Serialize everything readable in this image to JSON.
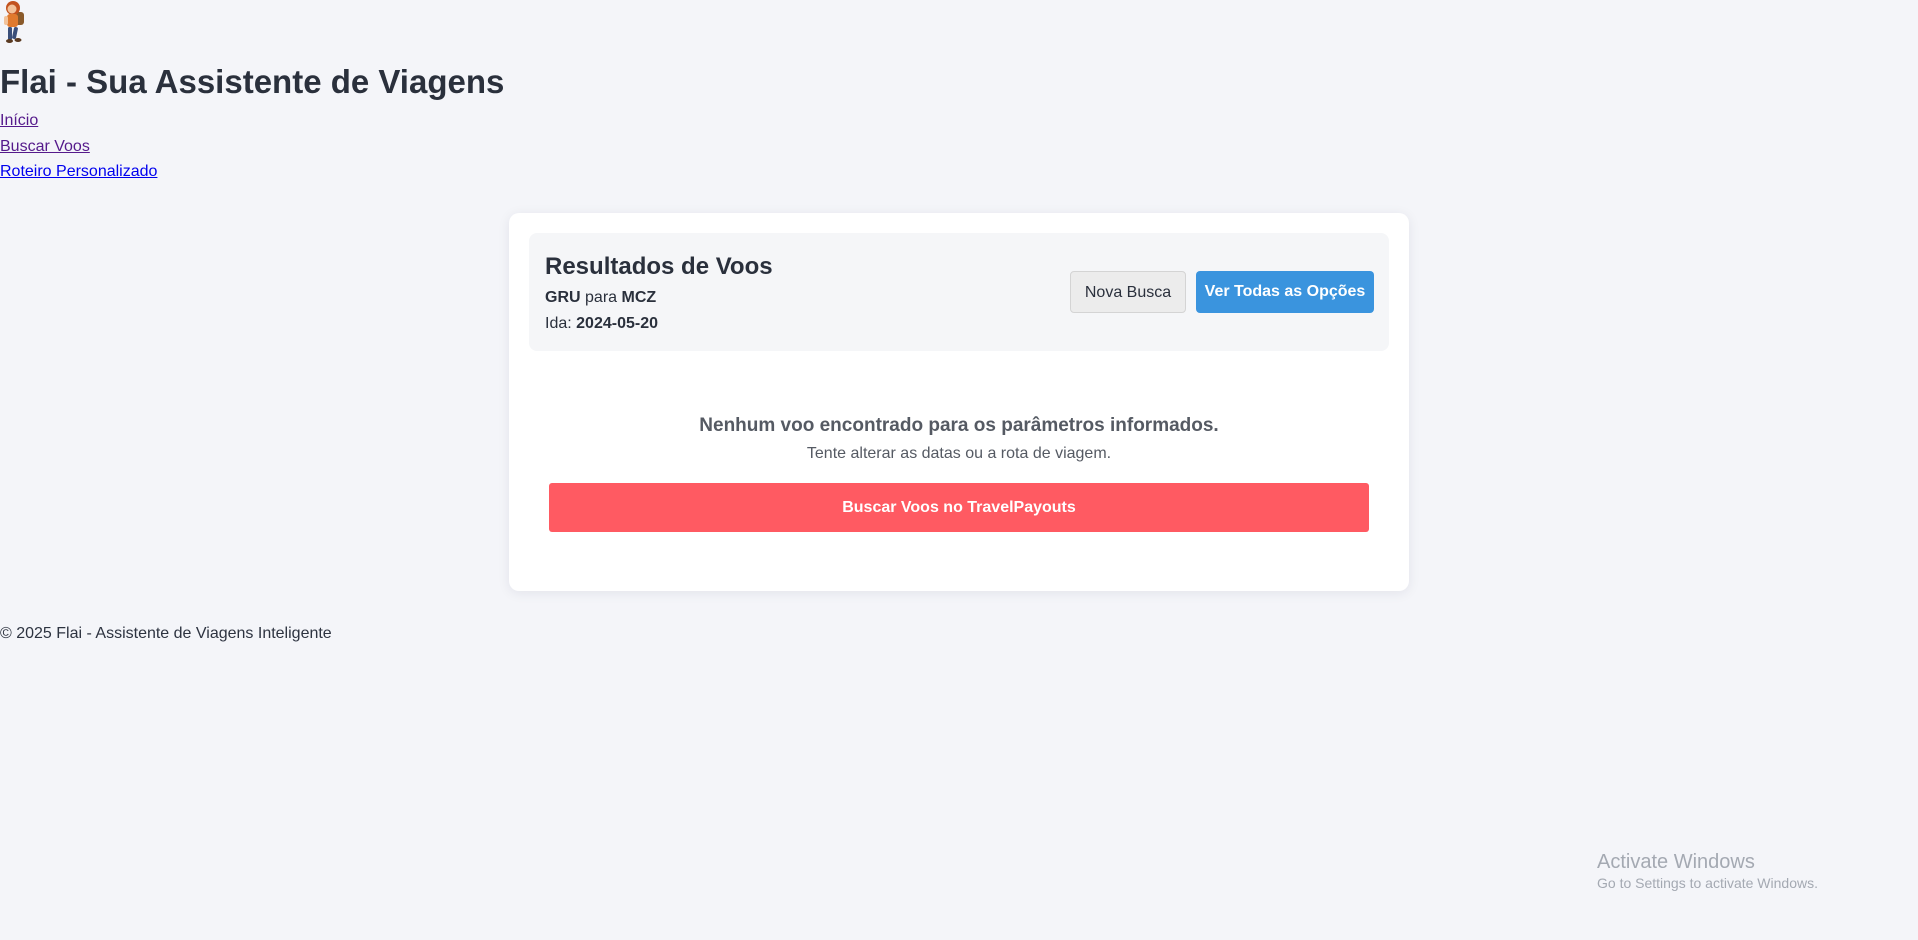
{
  "site": {
    "title": "Flai - Sua Assistente de Viagens"
  },
  "nav": {
    "items": [
      {
        "label": "Início"
      },
      {
        "label": "Buscar Voos"
      },
      {
        "label": "Roteiro Personalizado"
      }
    ]
  },
  "results": {
    "title": "Resultados de Voos",
    "origin": "GRU",
    "connector": "para",
    "destination": "MCZ",
    "date_label": "Ida:",
    "date_value": "2024-05-20",
    "new_search_label": "Nova Busca",
    "see_all_label": "Ver Todas as Opções"
  },
  "empty_state": {
    "message": "Nenhum voo encontrado para os parâmetros informados.",
    "hint": "Tente alterar as datas ou a rota de viagem.",
    "cta_label": "Buscar Voos no TravelPayouts"
  },
  "footer": {
    "text": "© 2025 Flai - Assistente de Viagens Inteligente"
  },
  "watermark": {
    "title": "Activate Windows",
    "subtitle": "Go to Settings to activate Windows."
  },
  "colors": {
    "background": "#f4f5f9",
    "primary_button": "#3a94de",
    "cta_button": "#ff5a62",
    "link_visited": "#551a8b",
    "link_unvisited": "#0000ee"
  },
  "icons": {
    "logo": "traveler-mascot-icon"
  }
}
